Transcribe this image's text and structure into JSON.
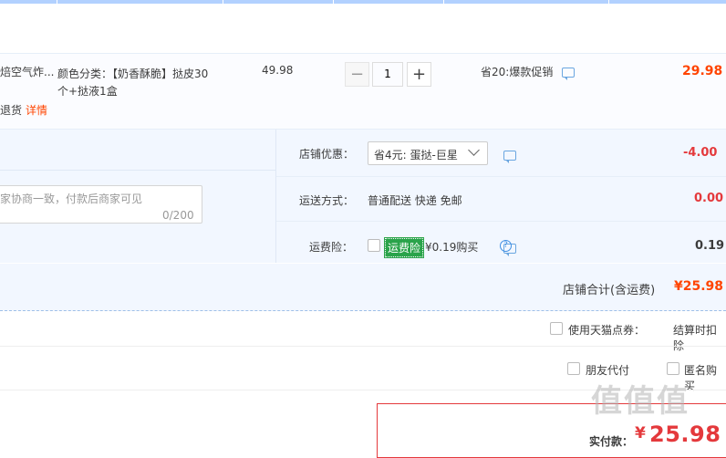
{
  "item": {
    "title": "焙空气炸...",
    "sku_line1": "颜色分类：【奶香酥脆】挞皮30",
    "sku_line2": "个+挞液1盒",
    "status": "退货",
    "detail_link": "详情",
    "unit_price": "49.98",
    "quantity": "1",
    "promo": "省20:爆款促销",
    "subtotal": "29.98"
  },
  "message": {
    "placeholder": "家协商一致，付款后商家可见",
    "counter": "0/200"
  },
  "order": {
    "shop_discount_label": "店铺优惠：",
    "shop_discount_selected": "省4元: 蛋挞-巨星",
    "shop_discount_value": "-4.00",
    "shipping_label": "运送方式：",
    "shipping_method": "普通配送 快递 免邮",
    "shipping_value": "0.00",
    "insurance_label": "运费险：",
    "insurance_badge": "运费险",
    "insurance_price": "¥0.19购买",
    "insurance_value": "0.19"
  },
  "store_total": {
    "label": "店铺合计(含运费)",
    "value": "¥25.98"
  },
  "tmall_coupon": {
    "label": "使用天猫点券：",
    "right": "结算时扣除"
  },
  "options": {
    "friend_pay": "朋友代付",
    "anonymous": "匿名购买"
  },
  "payment": {
    "label": "实付款：",
    "currency": "¥",
    "amount": "25.98"
  },
  "watermark": "值值值",
  "colors": {
    "accent": "#ff4400",
    "price_red": "#e4393c",
    "panel_blue": "#f2f7ff",
    "badge_green": "#2aa34a"
  }
}
